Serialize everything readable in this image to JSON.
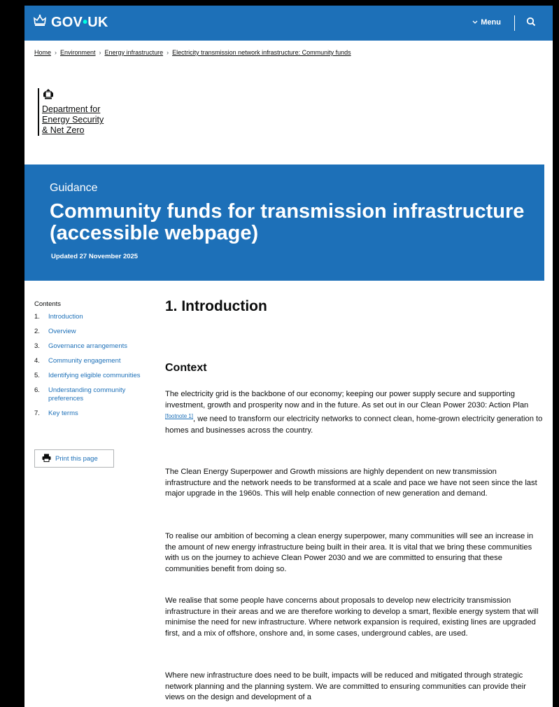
{
  "header": {
    "logo_text": "GOV·UK",
    "logo_text_left": "GOV",
    "logo_text_right": "UK",
    "menu_label": "Menu"
  },
  "breadcrumbs": [
    "Home",
    "Environment",
    "Energy infrastructure",
    "Electricity transmission network infrastructure: Community funds"
  ],
  "organisation": {
    "line1": "Department for",
    "line2": "Energy Security",
    "line3": "& Net Zero"
  },
  "banner": {
    "doc_type": "Guidance",
    "title": "Community funds for transmission infrastructure (accessible webpage)",
    "updated": "Updated 27 November 2025"
  },
  "contents": {
    "label": "Contents",
    "items": [
      {
        "num": "1.",
        "label": "Introduction"
      },
      {
        "num": "2.",
        "label": "Overview"
      },
      {
        "num": "3.",
        "label": "Governance arrangements"
      },
      {
        "num": "4.",
        "label": "Community engagement"
      },
      {
        "num": "5.",
        "label": "Identifying eligible communities"
      },
      {
        "num": "6.",
        "label": "Understanding community preferences"
      },
      {
        "num": "7.",
        "label": "Key terms"
      }
    ],
    "print_label": "Print this page"
  },
  "main": {
    "heading": "1. Introduction",
    "subheading": "Context",
    "para1_before": "The electricity grid is the backbone of our economy; keeping our power supply secure and supporting investment, growth and prosperity now and in the future. As set out in our Clean Power 2030: Action Plan ",
    "para1_footnote": "[footnote 1]",
    "para1_after": ", we need to transform our electricity networks to connect clean, home-grown electricity generation to homes and businesses across the country.",
    "para2": "The Clean Energy Superpower and Growth missions are highly dependent on new transmission infrastructure and the network needs to be transformed at a scale and pace we have not seen since the last major upgrade in the 1960s. This will help enable connection of new generation and demand.",
    "para3": "To realise our ambition of becoming a clean energy superpower, many communities will see an increase in the amount of new energy infrastructure being built in their area. It is vital that we bring these communities with us on the journey to achieve Clean Power 2030 and we are committed to ensuring that these communities benefit from doing so.",
    "para4": "We realise that some people have concerns about proposals to develop new electricity transmission infrastructure in their areas and we are therefore working to develop a smart, flexible energy system that will minimise the need for new infrastructure. Where network expansion is required, existing lines are upgraded first, and a mix of offshore, onshore and, in some cases, underground cables, are used.",
    "para5": "Where new infrastructure does need to be built, impacts will be reduced and mitigated through strategic network planning and the planning system. We are committed to ensuring communities can provide their views on the design and development of a"
  },
  "colors": {
    "brand_blue": "#1d70b8",
    "link": "#1d70b8",
    "text": "#0b0c0c",
    "logo_dot": "#00ffe0"
  },
  "icons": [
    "crown-icon",
    "chevron-down-icon",
    "search-icon",
    "crest-icon",
    "printer-icon"
  ]
}
